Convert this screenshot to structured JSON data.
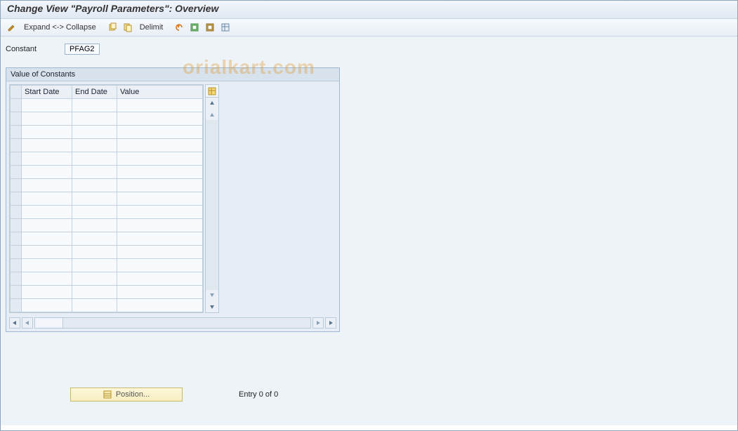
{
  "title": "Change View \"Payroll Parameters\": Overview",
  "toolbar": {
    "expand_collapse": "Expand <-> Collapse",
    "delimit": "Delimit"
  },
  "watermark": "orialkart.com",
  "constant": {
    "label": "Constant",
    "value": "PFAG2"
  },
  "panel": {
    "title": "Value of Constants",
    "columns": {
      "start": "Start Date",
      "end": "End Date",
      "value": "Value"
    },
    "rows": [
      {
        "start": "",
        "end": "",
        "value": ""
      },
      {
        "start": "",
        "end": "",
        "value": ""
      },
      {
        "start": "",
        "end": "",
        "value": ""
      },
      {
        "start": "",
        "end": "",
        "value": ""
      },
      {
        "start": "",
        "end": "",
        "value": ""
      },
      {
        "start": "",
        "end": "",
        "value": ""
      },
      {
        "start": "",
        "end": "",
        "value": ""
      },
      {
        "start": "",
        "end": "",
        "value": ""
      },
      {
        "start": "",
        "end": "",
        "value": ""
      },
      {
        "start": "",
        "end": "",
        "value": ""
      },
      {
        "start": "",
        "end": "",
        "value": ""
      },
      {
        "start": "",
        "end": "",
        "value": ""
      },
      {
        "start": "",
        "end": "",
        "value": ""
      },
      {
        "start": "",
        "end": "",
        "value": ""
      },
      {
        "start": "",
        "end": "",
        "value": ""
      },
      {
        "start": "",
        "end": "",
        "value": ""
      }
    ]
  },
  "footer": {
    "position_label": "Position...",
    "entry_text": "Entry 0 of 0"
  }
}
